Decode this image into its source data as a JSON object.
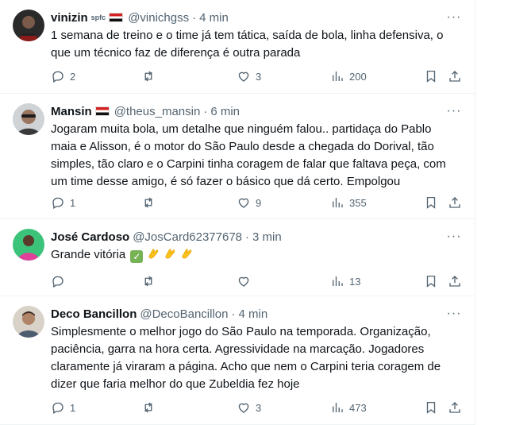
{
  "tweets": [
    {
      "name": "vinizin",
      "badge": "spfc",
      "handle": "@vinichgss",
      "time": "4 min",
      "text": "1 semana de treino e o time já tem tática, saída de bola, linha defensiva, o que um técnico faz de diferença é outra parada",
      "replies": "2",
      "retweets": "",
      "likes": "3",
      "views": "200"
    },
    {
      "name": "Mansin",
      "badge": "",
      "handle": "@theus_mansin",
      "time": "6 min",
      "text": "Jogaram muita bola, um detalhe que ninguém falou.. partidaça do Pablo maia e Alisson, é o motor do São Paulo desde a chegada do Dorival, tão simples, tão claro e o Carpini tinha coragem de falar que faltava peça, com um time desse amigo, é só fazer o básico que dá certo. Empolgou",
      "replies": "1",
      "retweets": "",
      "likes": "9",
      "views": "355"
    },
    {
      "name": "José Cardoso",
      "badge": "",
      "handle": "@JosCard62377678",
      "time": "3 min",
      "text": "Grande vitória",
      "replies": "",
      "retweets": "",
      "likes": "",
      "views": "13"
    },
    {
      "name": "Deco Bancillon",
      "badge": "",
      "handle": "@DecoBancillon",
      "time": "4 min",
      "text": "Simplesmente o melhor jogo do São Paulo na temporada. Organização, paciência, garra na hora certa. Agressividade na marcação. Jogadores claramente já viraram a página. Acho que nem o Carpini teria coragem de dizer que faria melhor do que Zubeldia fez hoje",
      "replies": "1",
      "retweets": "",
      "likes": "3",
      "views": "473"
    }
  ],
  "separator": "·",
  "more_glyph": "···",
  "colors": {
    "text": "#0f1419",
    "secondary": "#536471",
    "border": "#eff3f4",
    "check_emoji": "#77b255",
    "clap_emoji": "#fcc21b"
  },
  "icons": [
    "reply-icon",
    "retweet-icon",
    "like-icon",
    "views-icon",
    "bookmark-icon",
    "share-icon",
    "more-icon",
    "spfc-flag-icon",
    "check-emoji-icon",
    "clap-emoji-icon"
  ]
}
